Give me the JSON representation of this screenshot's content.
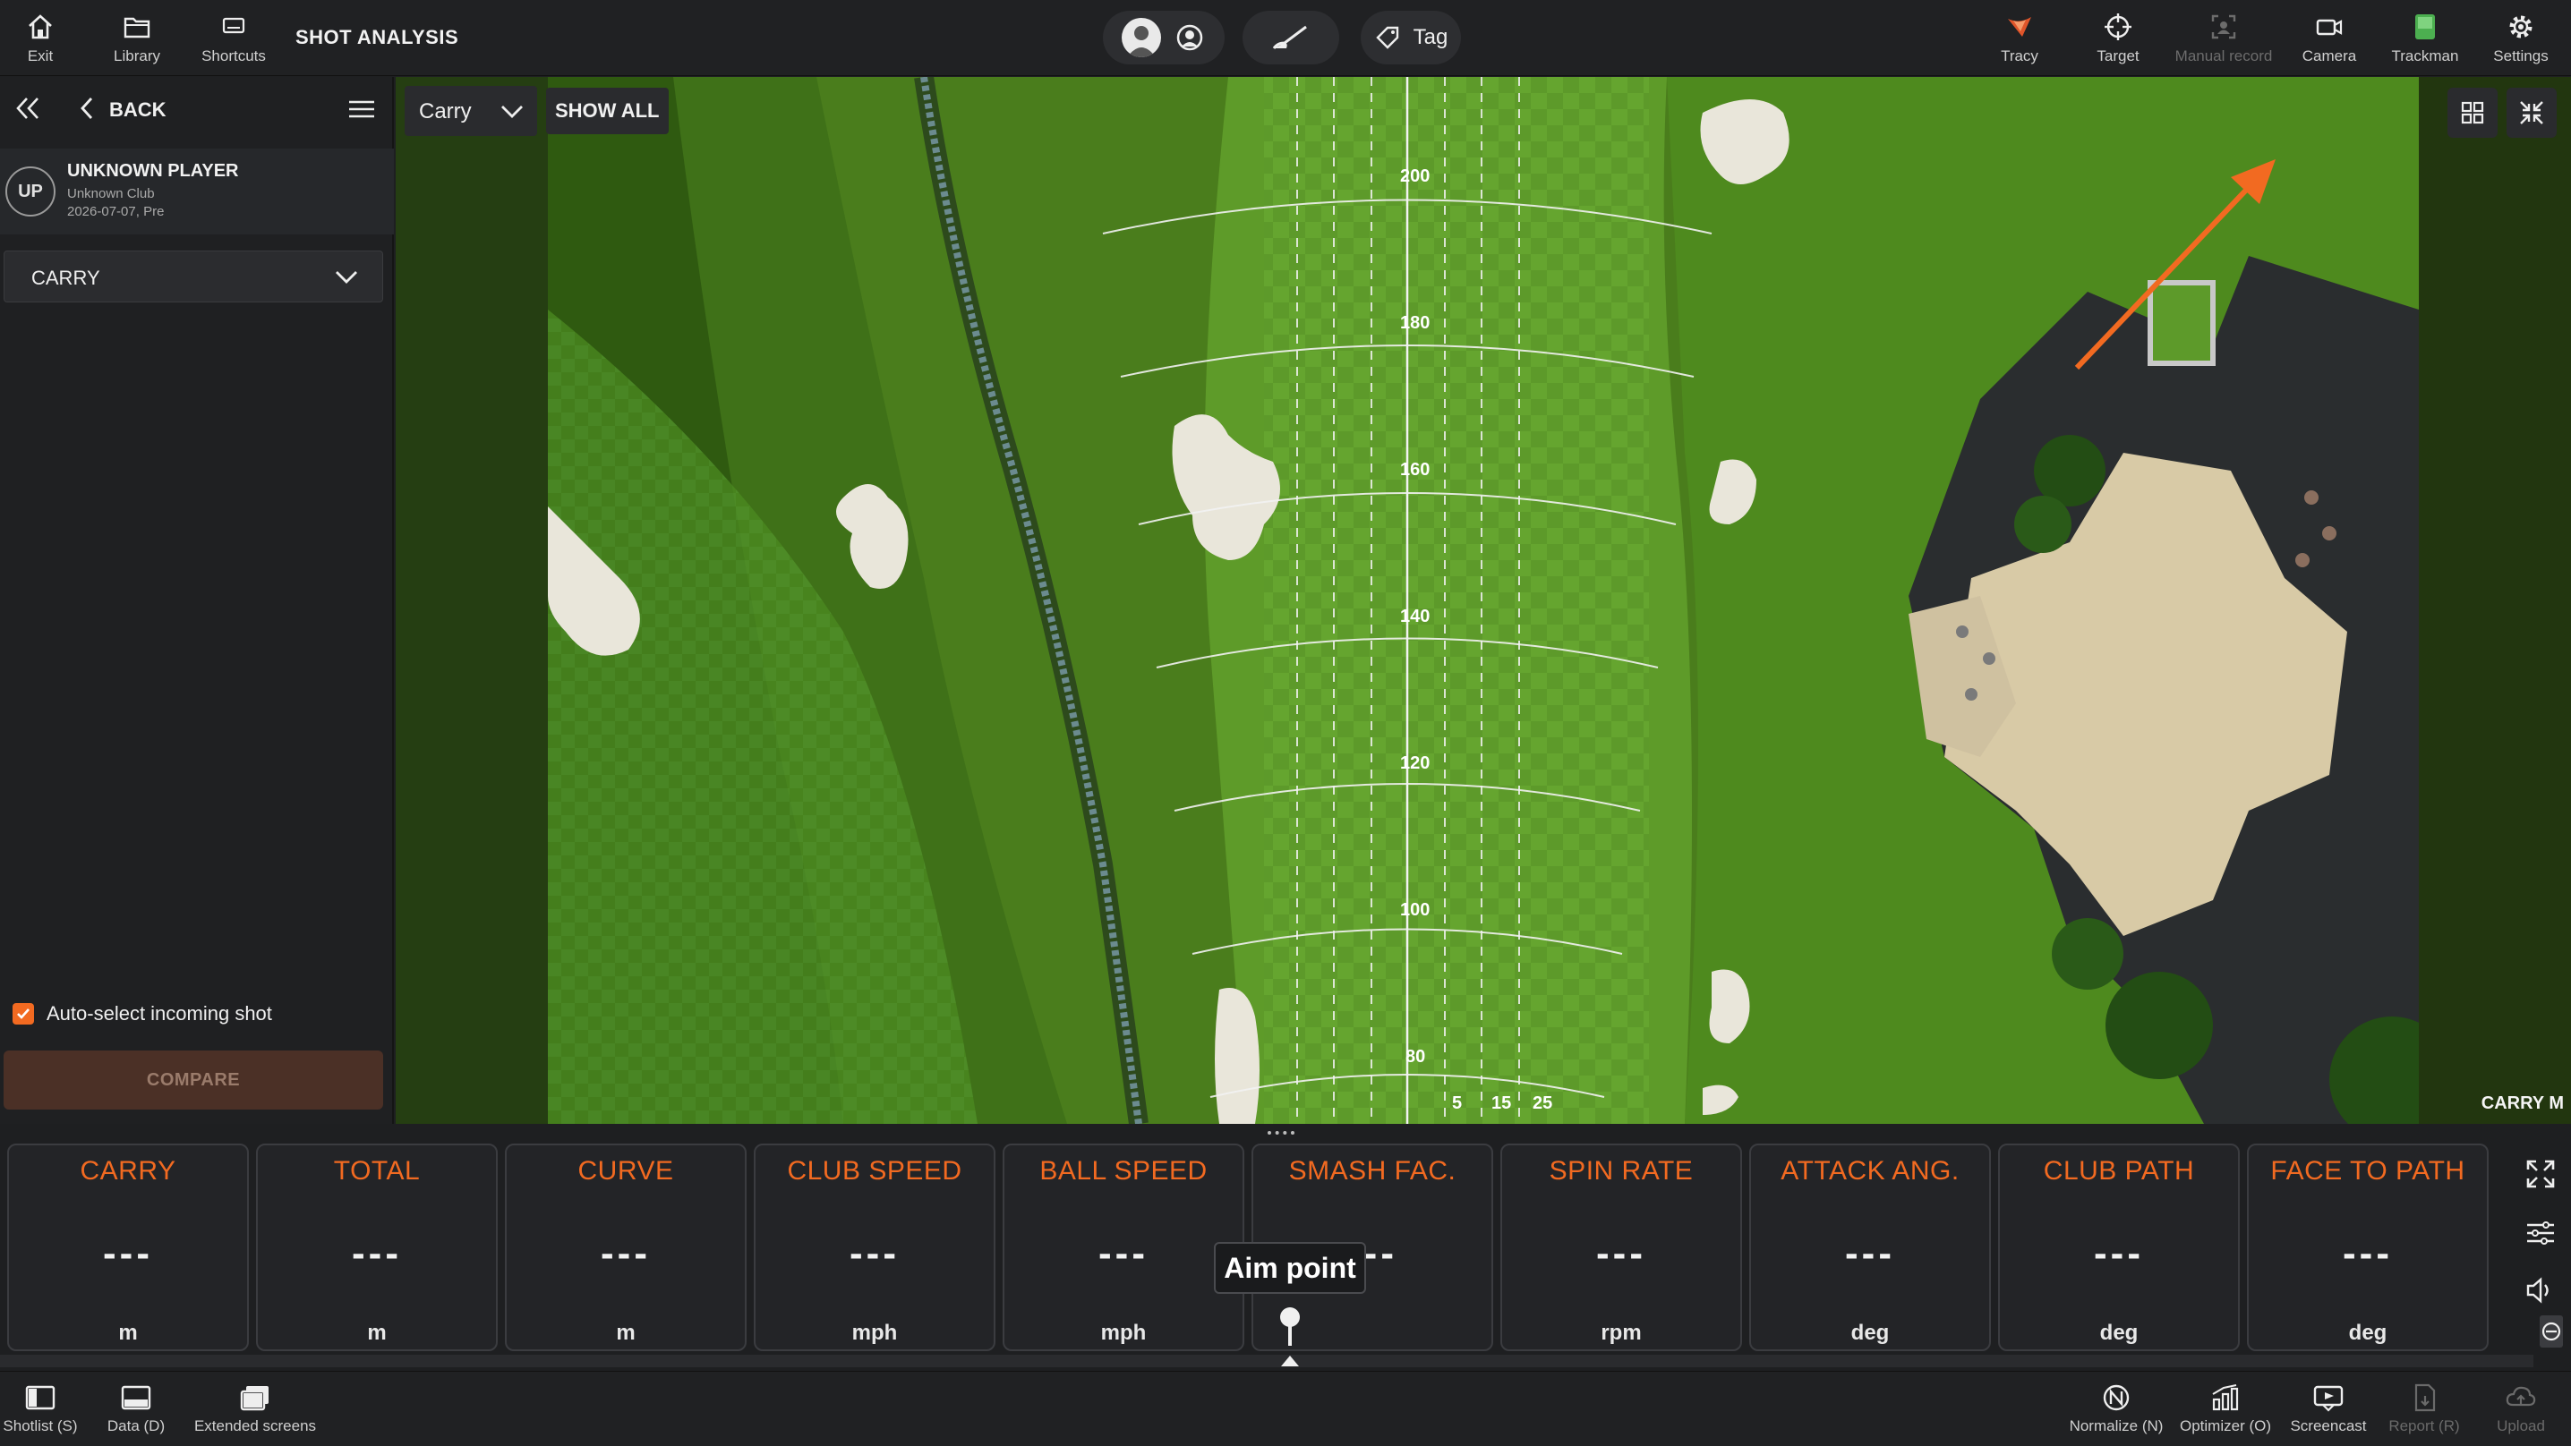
{
  "topbar": {
    "left_buttons": [
      {
        "label": "Exit",
        "icon": "home-icon"
      },
      {
        "label": "Library",
        "icon": "folder-icon"
      },
      {
        "label": "Shortcuts",
        "icon": "shortcuts-icon"
      }
    ],
    "title": "SHOT ANALYSIS",
    "tag_label": "Tag",
    "right_buttons": [
      {
        "label": "Tracy",
        "icon": "tracy-icon"
      },
      {
        "label": "Target",
        "icon": "target-icon"
      },
      {
        "label": "Manual record",
        "icon": "manual-record-icon",
        "disabled": true
      },
      {
        "label": "Camera",
        "icon": "camera-icon"
      },
      {
        "label": "Trackman",
        "icon": "trackman-icon"
      },
      {
        "label": "Settings",
        "icon": "gear-icon"
      }
    ]
  },
  "left_panel": {
    "back_label": "BACK",
    "player": {
      "initials": "UP",
      "name": "UNKNOWN PLAYER",
      "club": "Unknown Club",
      "date": "2026-07-07, Pre"
    },
    "metric_select": "CARRY",
    "auto_select_label": "Auto-select incoming shot",
    "auto_select_checked": true,
    "compare_label": "COMPARE"
  },
  "map": {
    "dropdown_value": "Carry",
    "show_all_label": "SHOW ALL",
    "distance_labels": [
      "200",
      "180",
      "160",
      "140",
      "120",
      "100",
      "80"
    ],
    "lateral_labels": [
      "5",
      "15",
      "25"
    ],
    "corner_label": "CARRY  M"
  },
  "metrics": [
    {
      "label": "CARRY",
      "value": "---",
      "unit": "m"
    },
    {
      "label": "TOTAL",
      "value": "---",
      "unit": "m"
    },
    {
      "label": "CURVE",
      "value": "---",
      "unit": "m"
    },
    {
      "label": "CLUB SPEED",
      "value": "---",
      "unit": "mph"
    },
    {
      "label": "BALL SPEED",
      "value": "---",
      "unit": "mph"
    },
    {
      "label": "SMASH FAC.",
      "value": "---",
      "unit": ""
    },
    {
      "label": "SPIN RATE",
      "value": "---",
      "unit": "rpm"
    },
    {
      "label": "ATTACK ANG.",
      "value": "---",
      "unit": "deg"
    },
    {
      "label": "CLUB PATH",
      "value": "---",
      "unit": "deg"
    },
    {
      "label": "FACE TO PATH",
      "value": "---",
      "unit": "deg"
    }
  ],
  "aim_tooltip": "Aim point",
  "bottombar": {
    "left": [
      {
        "label": "Shotlist (S)",
        "icon": "shotlist-icon"
      },
      {
        "label": "Data (D)",
        "icon": "data-icon"
      },
      {
        "label": "Extended screens",
        "icon": "extended-screens-icon"
      }
    ],
    "right": [
      {
        "label": "Normalize (N)",
        "icon": "normalize-icon"
      },
      {
        "label": "Optimizer (O)",
        "icon": "optimizer-icon"
      },
      {
        "label": "Screencast",
        "icon": "screencast-icon"
      },
      {
        "label": "Report (R)",
        "icon": "report-icon",
        "disabled": true
      },
      {
        "label": "Upload",
        "icon": "upload-icon",
        "disabled": true
      }
    ]
  },
  "colors": {
    "accent": "#f26a21",
    "trackman_green": "#4caf50",
    "panel": "#1f2022"
  }
}
